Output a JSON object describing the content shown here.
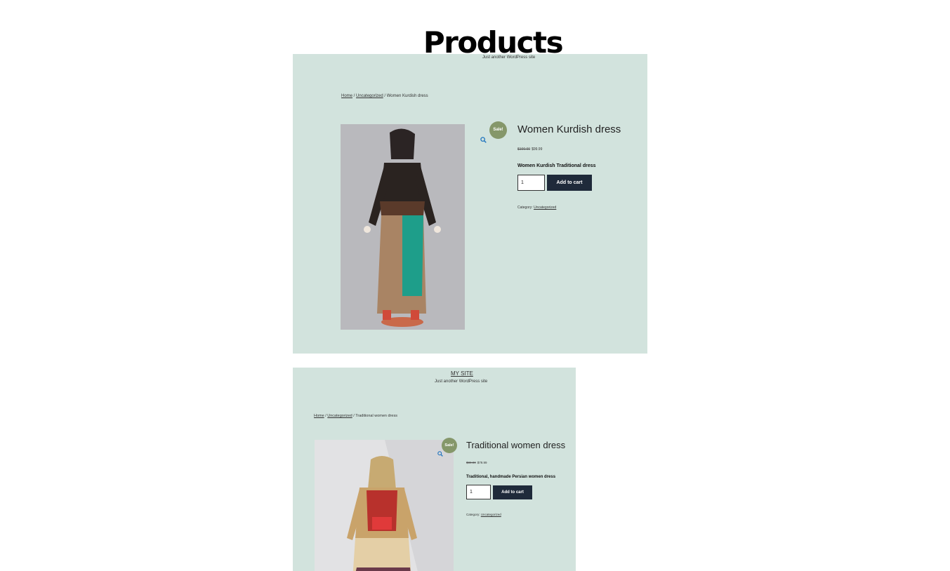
{
  "page": {
    "title": "Products"
  },
  "products": [
    {
      "site_title": "",
      "tagline": "Just another WordPress site",
      "breadcrumb": {
        "home": "Home",
        "sep1": " / ",
        "category": "Uncategorized",
        "sep2": " / ",
        "current": "Women Kurdish dress"
      },
      "sale_badge": "Sale!",
      "name": "Women Kurdish dress",
      "price_old": "$100.00",
      "price_new": "$99.99",
      "short_description": "Women Kurdish Traditional dress",
      "quantity": "1",
      "add_to_cart": "Add to cart",
      "category_label": "Category:",
      "category": "Uncategorized",
      "image_alt": "Women Kurdish dress on mannequin"
    },
    {
      "site_title": "MY SITE",
      "tagline": "Just another WordPress site",
      "breadcrumb": {
        "home": "Home",
        "sep1": " / ",
        "category": "Uncategorized",
        "sep2": " / ",
        "current": "Traditional women dress"
      },
      "sale_badge": "Sale!",
      "name": "Traditional women dress",
      "price_old": "$80.00",
      "price_new": "$79.99",
      "short_description": "Traditional, handmade Persian women dress",
      "quantity": "1",
      "add_to_cart": "Add to cart",
      "category_label": "Category:",
      "category": "Uncategorized",
      "image_alt": "Traditional women dress on mannequin"
    }
  ],
  "colors": {
    "page_bg": "#ffffff",
    "frame_bg": "#d2e3dd",
    "sale_badge": "#85976a",
    "button": "#1f2a3a",
    "zoom_icon": "#1e73be"
  },
  "icons": {
    "zoom": "magnifier-icon"
  }
}
